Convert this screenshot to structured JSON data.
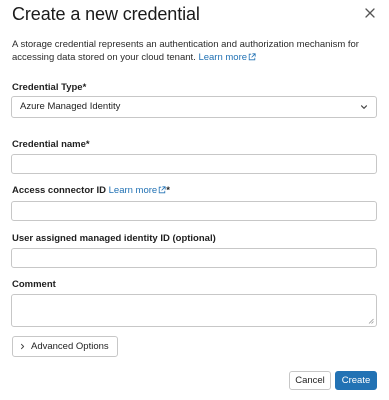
{
  "dialog": {
    "title": "Create a new credential",
    "description": "A storage credential represents an authentication and authorization mechanism for accessing data stored on your cloud tenant.",
    "learn_more": "Learn more"
  },
  "form": {
    "credential_type": {
      "label": "Credential Type*",
      "value": "Azure Managed Identity"
    },
    "credential_name": {
      "label": "Credential name*",
      "value": ""
    },
    "access_connector": {
      "label": "Access connector ID",
      "link": "Learn more",
      "required_mark": "*",
      "value": ""
    },
    "managed_identity": {
      "label": "User assigned managed identity ID (optional)",
      "value": ""
    },
    "comment": {
      "label": "Comment",
      "value": ""
    }
  },
  "advanced_options_label": "Advanced Options",
  "buttons": {
    "cancel": "Cancel",
    "create": "Create"
  },
  "colors": {
    "accent": "#2272b4",
    "border": "#c7c7c7"
  }
}
